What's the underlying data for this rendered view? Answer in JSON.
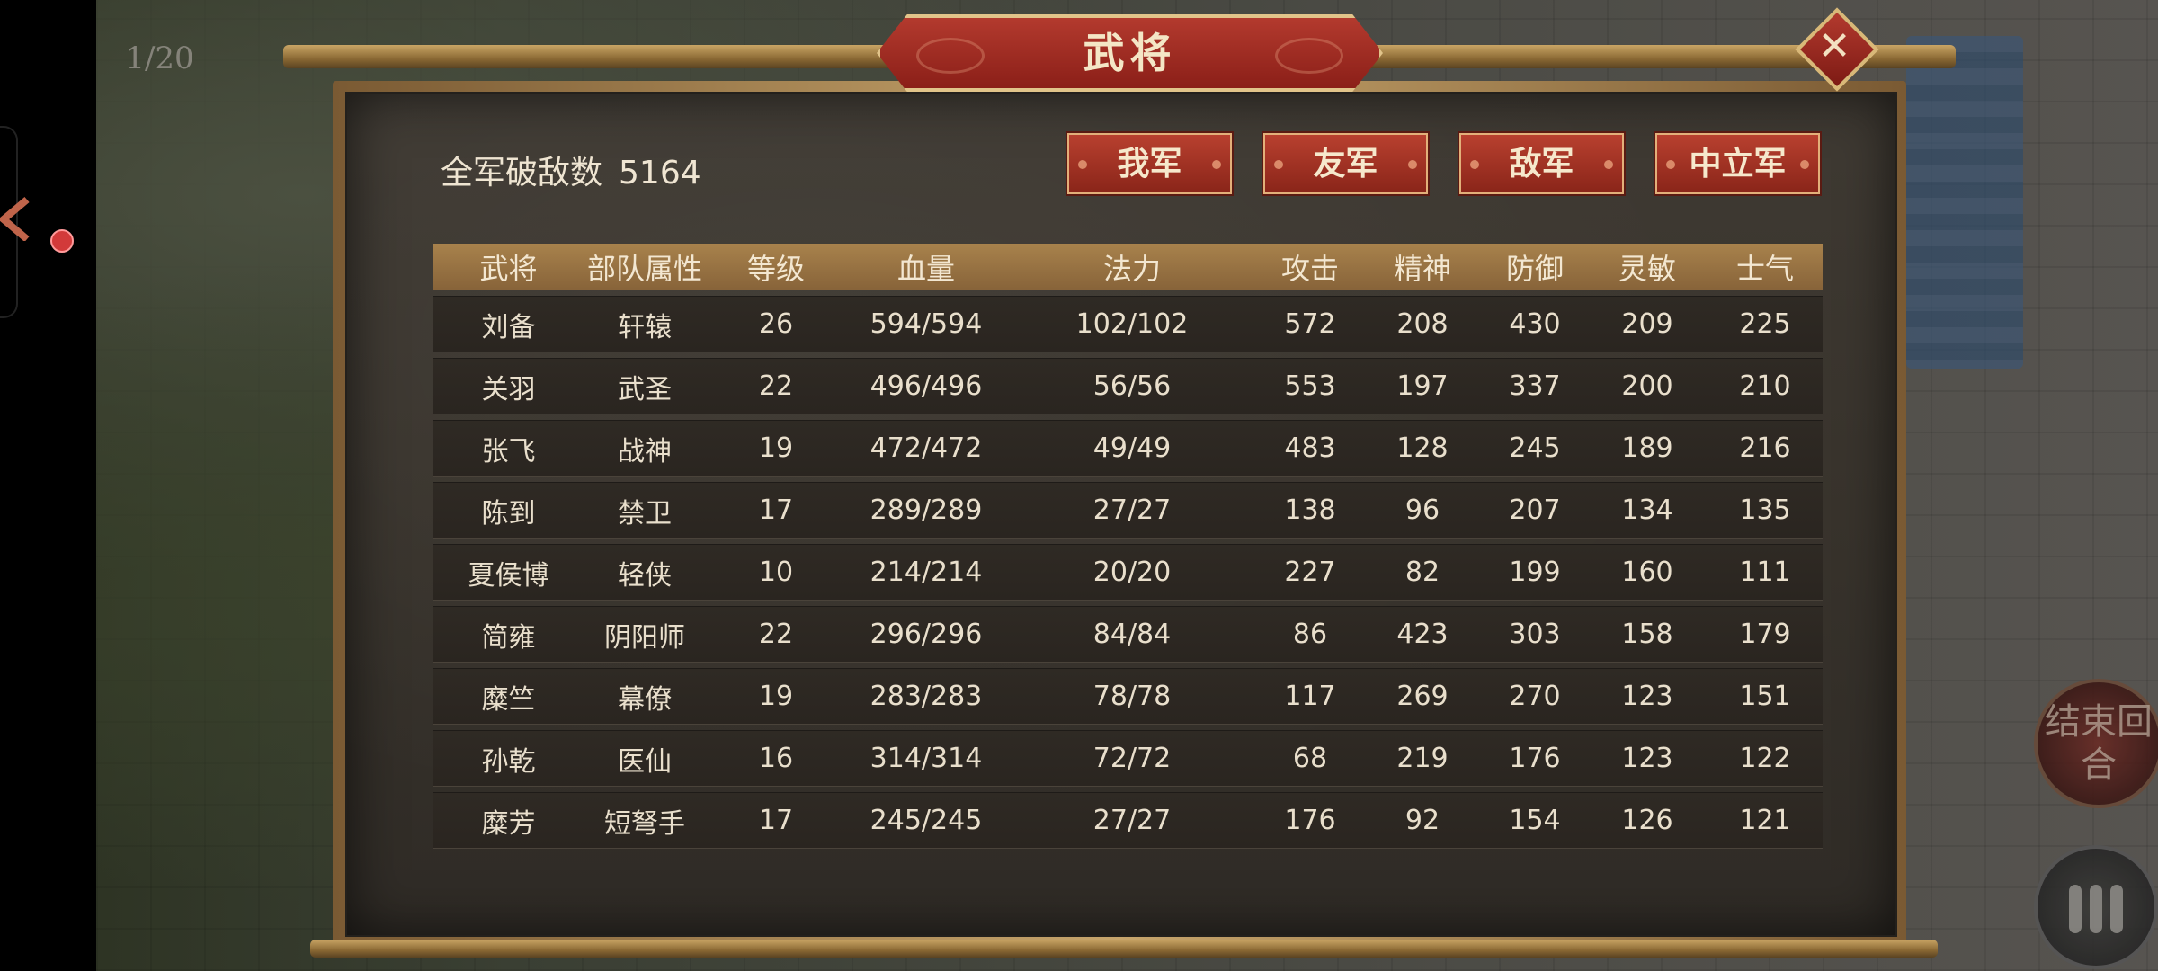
{
  "hud": {
    "turn_counter": "1/20",
    "end_turn_label": "结束回合"
  },
  "dialog": {
    "title": "武将",
    "close_label": "✕",
    "kill_count_label": "全军破敌数",
    "kill_count_value": "5164",
    "faction_tabs": [
      "我军",
      "友军",
      "敌军",
      "中立军"
    ],
    "columns": [
      "武将",
      "部队属性",
      "等级",
      "血量",
      "法力",
      "攻击",
      "精神",
      "防御",
      "灵敏",
      "士气"
    ],
    "rows": [
      [
        "刘备",
        "轩辕",
        "26",
        "594/594",
        "102/102",
        "572",
        "208",
        "430",
        "209",
        "225"
      ],
      [
        "关羽",
        "武圣",
        "22",
        "496/496",
        "56/56",
        "553",
        "197",
        "337",
        "200",
        "210"
      ],
      [
        "张飞",
        "战神",
        "19",
        "472/472",
        "49/49",
        "483",
        "128",
        "245",
        "189",
        "216"
      ],
      [
        "陈到",
        "禁卫",
        "17",
        "289/289",
        "27/27",
        "138",
        "96",
        "207",
        "134",
        "135"
      ],
      [
        "夏侯博",
        "轻侠",
        "10",
        "214/214",
        "20/20",
        "227",
        "82",
        "199",
        "160",
        "111"
      ],
      [
        "简雍",
        "阴阳师",
        "22",
        "296/296",
        "84/84",
        "86",
        "423",
        "303",
        "158",
        "179"
      ],
      [
        "糜竺",
        "幕僚",
        "19",
        "283/283",
        "78/78",
        "117",
        "269",
        "270",
        "123",
        "151"
      ],
      [
        "孙乾",
        "医仙",
        "16",
        "314/314",
        "72/72",
        "68",
        "219",
        "176",
        "123",
        "122"
      ],
      [
        "糜芳",
        "短弩手",
        "17",
        "245/245",
        "27/27",
        "176",
        "92",
        "154",
        "126",
        "121"
      ]
    ]
  }
}
